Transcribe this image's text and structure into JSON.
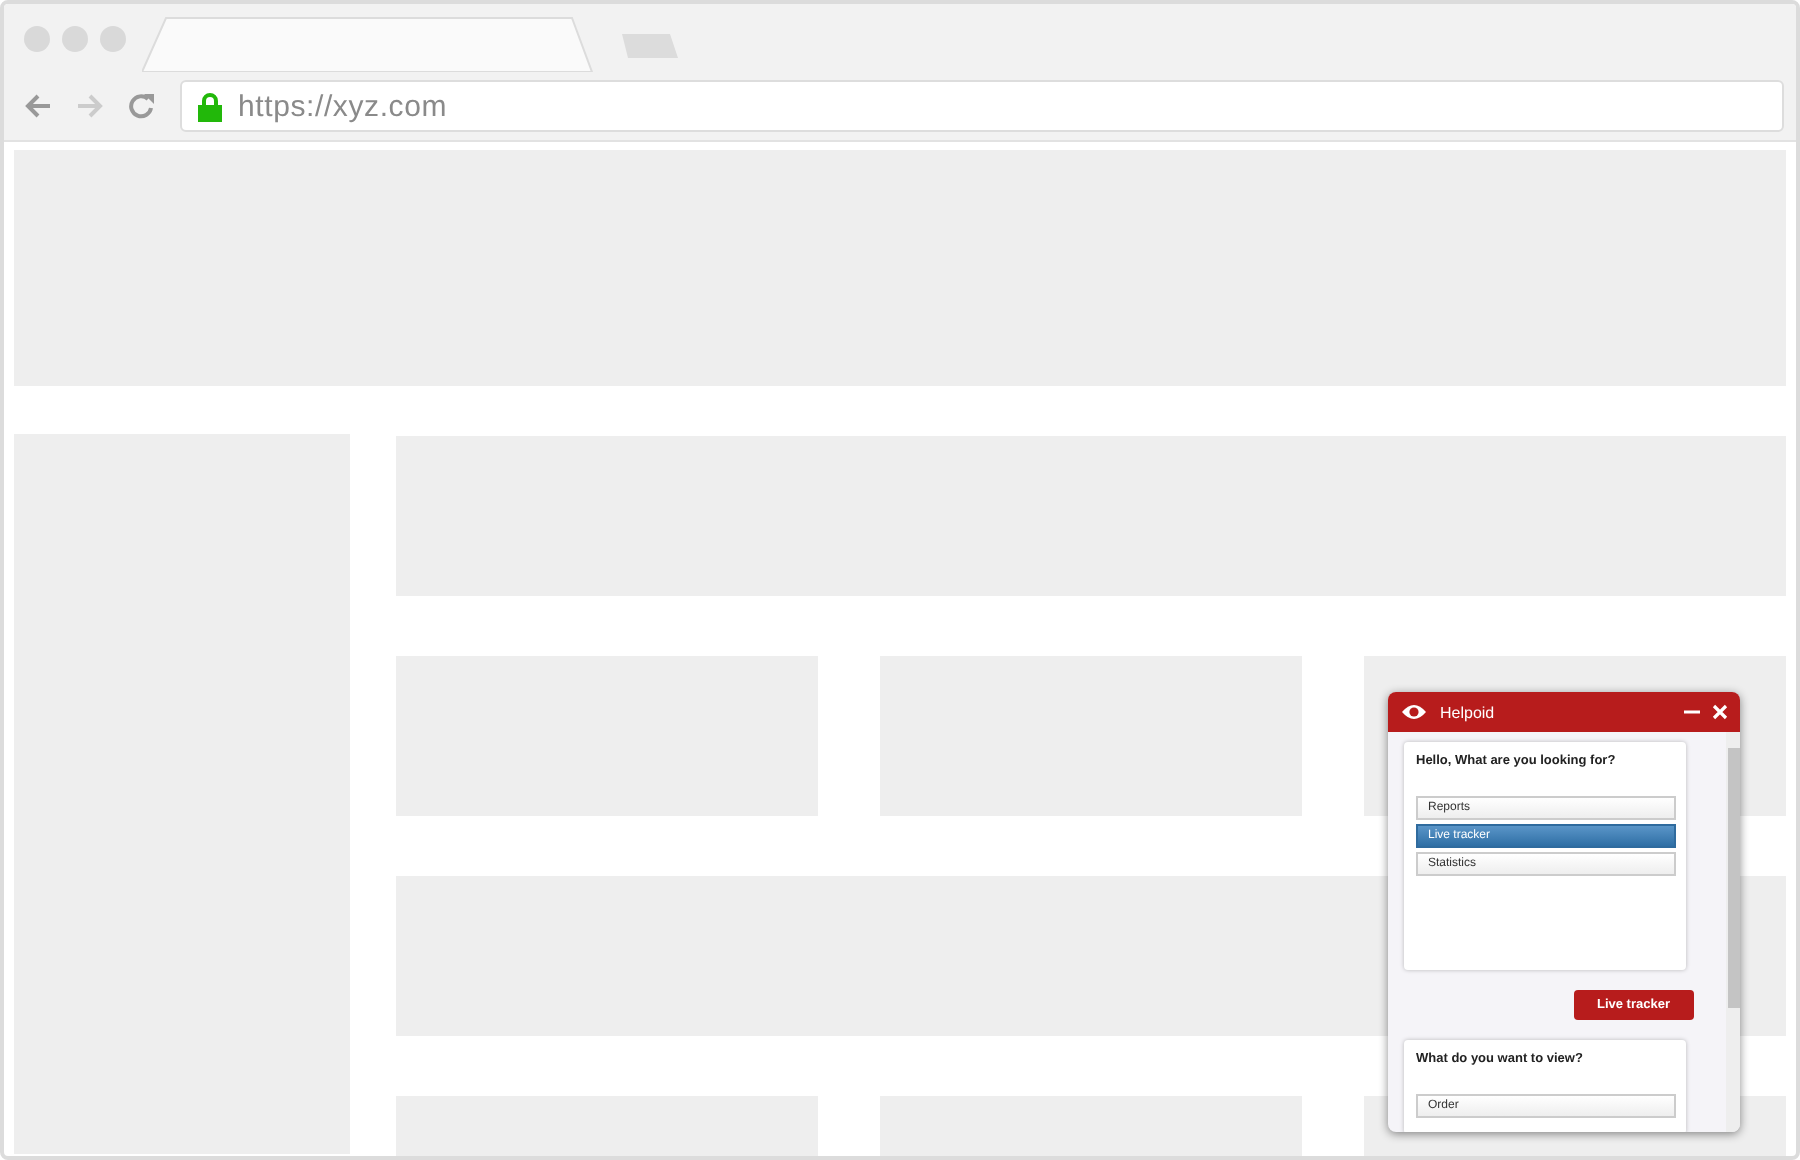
{
  "browser": {
    "url": "https://xyz.com"
  },
  "chat": {
    "title": "Helpoid",
    "messages": [
      {
        "kind": "bot",
        "text": "Hello, What are you looking for?",
        "options": [
          {
            "label": "Reports",
            "selected": false
          },
          {
            "label": "Live tracker",
            "selected": true
          },
          {
            "label": "Statistics",
            "selected": false
          }
        ]
      },
      {
        "kind": "user",
        "text": "Live tracker"
      },
      {
        "kind": "bot",
        "text": "What do you want to view?",
        "options": [
          {
            "label": "Order",
            "selected": false
          }
        ]
      }
    ]
  }
}
